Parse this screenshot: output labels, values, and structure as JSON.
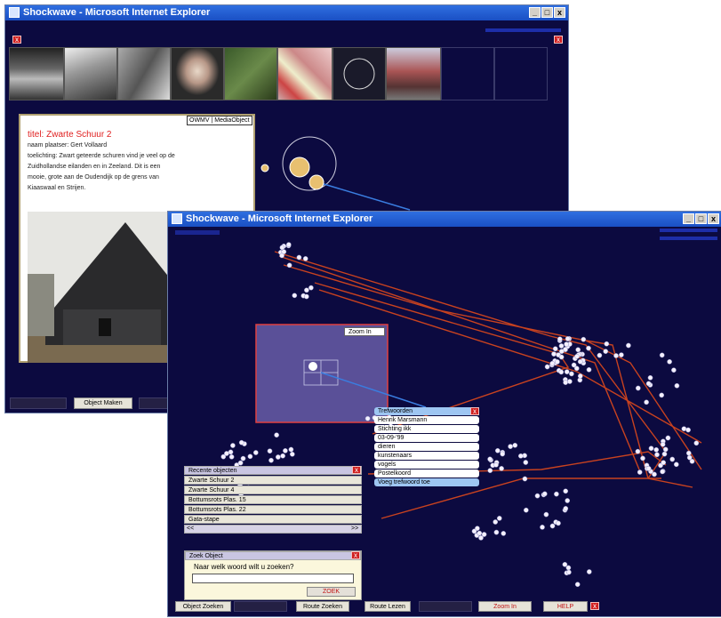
{
  "window_back": {
    "title": "Shockwave - Microsoft Internet Explorer",
    "controls": [
      "_",
      "□",
      "x"
    ],
    "panel": {
      "title": "titel: Zwarte Schuur 2",
      "lines": [
        "naam plaatser: Gert Vollaard",
        "toelichting: Zwart geteerde schuren vind je veel op de",
        "Zuidhollandse eilanden en in Zeeland. Dit is een",
        "mooie, grote aan de Oudendijk op de grens van",
        "Kiaaswaal en Strijen."
      ],
      "tag": "OWMV | MediaObject"
    },
    "toolbar": {
      "object_maken": "Object Maken"
    }
  },
  "window_front": {
    "title": "Shockwave - Microsoft Internet Explorer",
    "controls": [
      "_",
      "□",
      "x"
    ],
    "zoom_box_label": "Zoom In",
    "menu": [
      "Trefwoorden",
      "Henrik Marsmann",
      "Stichting ikk",
      "03-09-'99",
      "dieren",
      "kunstenaars",
      "vogels",
      "Postelkoord",
      "Voeg trefwoord toe"
    ],
    "recent": {
      "header": "Recente objecten",
      "items": [
        "Zwarte Schuur 2",
        "Zwarte Schuur 4",
        "Bottumsrots Plas. 15",
        "Bottumsrots Plas. 22",
        "Gata-stape"
      ],
      "scroll_left": "<<",
      "scroll_right": ">>"
    },
    "search": {
      "header": "Zoek Object",
      "question": "Naar welk woord wilt u zoeken?",
      "input_value": "",
      "button": "ZOEK"
    },
    "toolbar": {
      "object_zoeken": "Object Zoeken",
      "route_zoeken": "Route Zoeken",
      "route_lezen": "Route Lezen",
      "zoom_in": "Zoom In",
      "help": "HELP"
    }
  },
  "colors": {
    "canvas": "#0c0a40",
    "route_lines": "#c8421f",
    "title_bar": "#1f57cf",
    "highlight": "#9ec6f2"
  }
}
